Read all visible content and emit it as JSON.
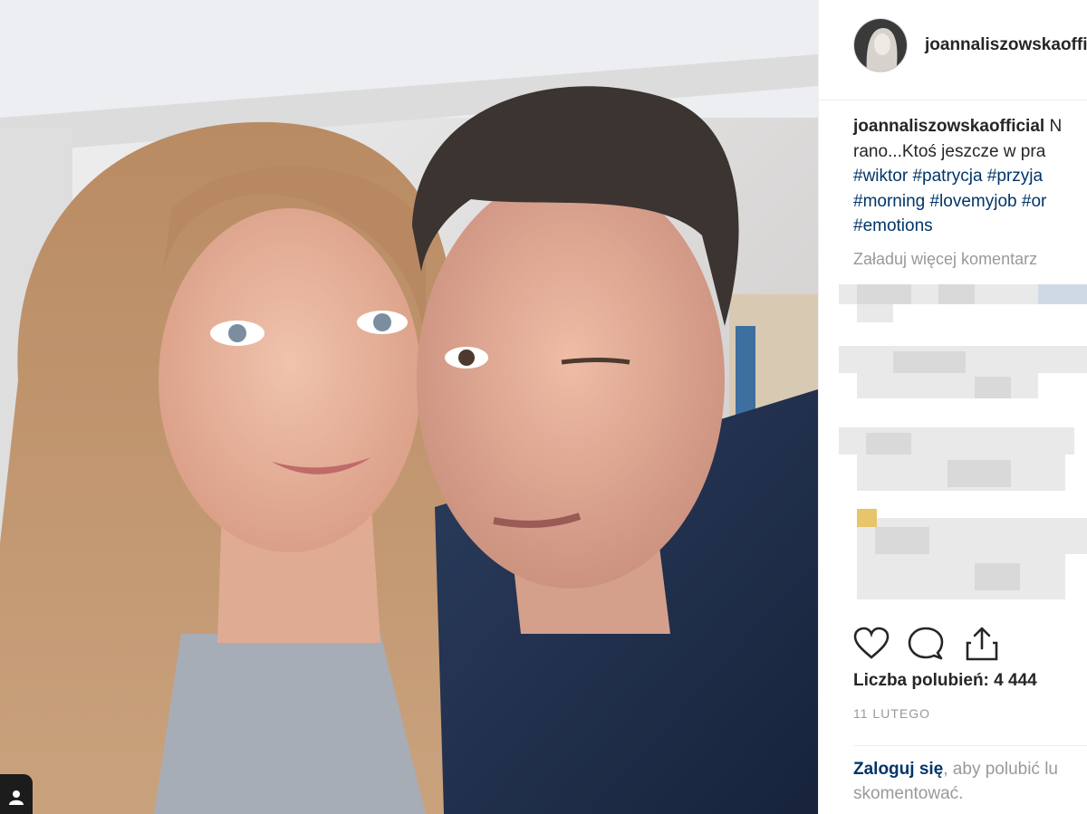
{
  "post": {
    "username": "joannaliszowskaofficial",
    "caption": {
      "user": "joannaliszowskaofficial",
      "text_start": " N",
      "line2": "rano...Ktoś jeszcze w pra",
      "hashtags_line1": "#wiktor #patrycja #przyja",
      "hashtags_line2": "#morning #lovemyjob #or",
      "hashtags_line3": "#emotions"
    },
    "load_more_comments": "Załaduj więcej komentarz",
    "likes": "Liczba polubień: 4 444",
    "date": "11 LUTEGO",
    "login": {
      "link": "Zaloguj się",
      "rest": ", aby polubić lu",
      "line2": "skomentować."
    }
  },
  "icons": {
    "like": "heart-icon",
    "comment": "comment-icon",
    "share": "share-icon",
    "tag": "user-tag-icon"
  },
  "colors": {
    "link": "#003569",
    "muted": "#999999",
    "text": "#262626"
  }
}
